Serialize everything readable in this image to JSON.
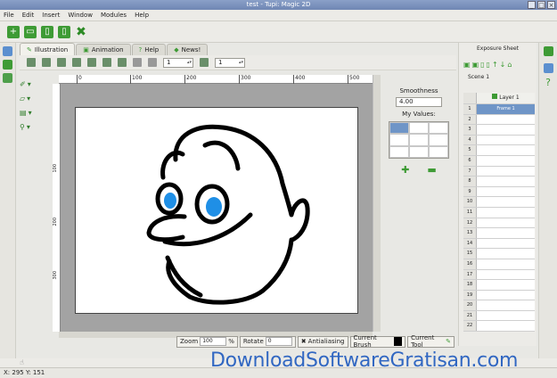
{
  "window": {
    "title": "test - Tupi: Magic 2D",
    "controls": [
      "_",
      "□",
      "×"
    ]
  },
  "menu": [
    "File",
    "Edit",
    "Insert",
    "Window",
    "Modules",
    "Help"
  ],
  "tabs": [
    {
      "label": "Illustration",
      "icon": "pencil-icon"
    },
    {
      "label": "Animation",
      "icon": "film-icon"
    },
    {
      "label": "Help",
      "icon": "question-icon"
    },
    {
      "label": "News!",
      "icon": "news-icon"
    }
  ],
  "subtoolbar": {
    "onion_value": "1",
    "frames_value": "1"
  },
  "ruler_h": [
    "0",
    "100",
    "200",
    "300",
    "400",
    "500"
  ],
  "ruler_v": [
    "100",
    "200",
    "300"
  ],
  "right_panel": {
    "smoothness_label": "Smoothness",
    "smoothness_value": "4.00",
    "values_label": "My Values:",
    "add_icon": "plus-icon",
    "remove_icon": "minus-icon"
  },
  "status": {
    "zoom_label": "Zoom",
    "zoom_value": "100",
    "zoom_unit": "%",
    "rotate_label": "Rotate",
    "rotate_value": "0",
    "antialiasing_label": "Antialiasing",
    "current_brush_label": "Current Brush",
    "current_tool_label": "Current Tool"
  },
  "exposure": {
    "title": "Exposure Sheet",
    "scene": "Scene 1",
    "layer": "Layer 1",
    "frame1": "Frame 1",
    "rows": [
      "1",
      "2",
      "3",
      "4",
      "5",
      "6",
      "7",
      "8",
      "9",
      "10",
      "11",
      "12",
      "13",
      "14",
      "15",
      "16",
      "17",
      "18",
      "19",
      "20",
      "21",
      "22"
    ]
  },
  "coords": "X: 295 Y: 151",
  "watermark": "DownloadSoftwareGratisan.com",
  "colors": {
    "eye": "#1f8fe6",
    "accent_green": "#3e9b35",
    "selection": "#6f95c7"
  }
}
